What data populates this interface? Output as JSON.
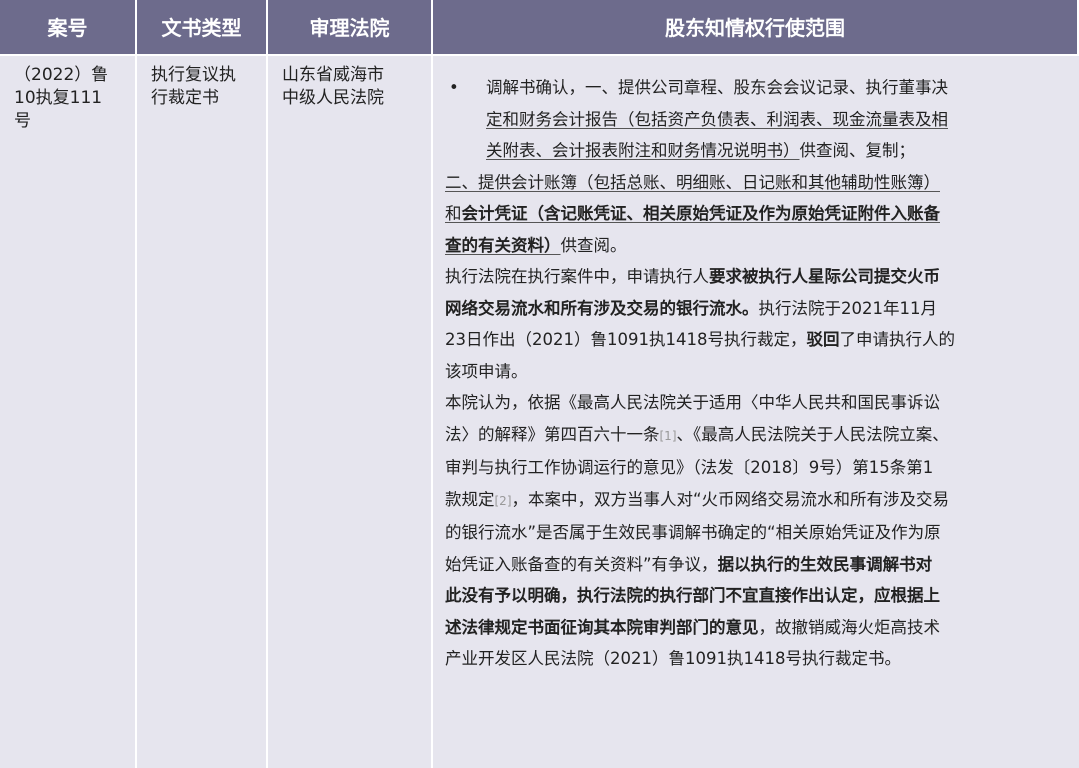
{
  "headers": [
    "案号",
    "文书类型",
    "审理法院",
    "股东知情权行使范围"
  ],
  "row": {
    "case_no_lines": [
      "（2022）鲁",
      "10执复111",
      "号"
    ],
    "doc_type_lines": [
      "执行复议执",
      "行裁定书"
    ],
    "court_lines": [
      "山东省威海市",
      "中级人民法院"
    ],
    "scope": {
      "bullet": "•",
      "l1": "调解书确认，一、提供公司章程、股东会会议记录、执行董事决",
      "l2": "定和财务会计报告（包括资产负债表、利润表、现金流量表及相",
      "l3a": "关附表、会计报表附注和财务情况说明书）",
      "l3b": "供查阅、复制；",
      "l4": "二、提供会计账簿（包括总账、明细账、日记账和其他辅助性账簿）",
      "l5a": "和",
      "l5b": "会计凭证（含记账凭证、相关原始凭证及作为原始凭证附件入账备",
      "l6a": "查的有关资料）",
      "l6b": "供查阅。",
      "l7a": "执行法院在执行案件中，申请执行人",
      "l7b": "要求被执行人星际公司提交火币",
      "l8a": "网络交易流水和所有涉及交易的银行流水。",
      "l8b": "执行法院于2021年11月",
      "l9a": "23日作出（2021）鲁1091执1418号执行裁定，",
      "l9b": "驳回",
      "l9c": "了申请执行人的",
      "l10": "该项申请。",
      "l11": "本院认为，依据《最高人民法院关于适用〈中华人民共和国民事诉讼",
      "l12a": "法〉的解释》第四百六十一条",
      "ref1": "[1]",
      "l12b": "、《最高人民法院关于人民法院立案、",
      "l13": "审判与执行工作协调运行的意见》（法发〔2018〕9号）第15条第1",
      "l14a": "款规定",
      "ref2": "[2]",
      "l14b": "，本案中，双方当事人对“火币网络交易流水和所有涉及交易",
      "l15": "的银行流水”是否属于生效民事调解书确定的“相关原始凭证及作为原",
      "l16a": "始凭证入账备查的有关资料”有争议，",
      "l16b": "据以执行的生效民事调解书对",
      "l17": "此没有予以明确，执行法院的执行部门不宜直接作出认定，应根据上",
      "l18a": "述法律规定书面征询其本院审判部门的意见",
      "l18b": "，故撤销威海火炬高技术",
      "l19": "产业开发区人民法院（2021）鲁1091执1418号执行裁定书。"
    }
  }
}
